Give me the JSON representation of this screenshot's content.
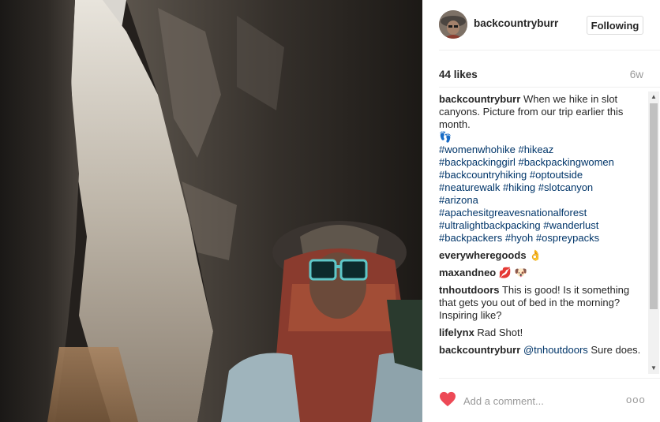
{
  "post": {
    "username": "backcountryburr",
    "follow_label": "Following",
    "likes": "44 likes",
    "age": "6w"
  },
  "caption": {
    "username": "backcountryburr",
    "text": "When we hike in slot canyons. Picture from our trip earlier this month.",
    "emoji": "👣",
    "hashtag_lines": [
      [
        "#womenwhohike",
        "#hikeaz"
      ],
      [
        "#backpackinggirl",
        "#backpackingwomen"
      ],
      [
        "#backcountryhiking",
        "#optoutside"
      ],
      [
        "#neaturewalk",
        "#hiking",
        "#slotcanyon"
      ],
      [
        "#arizona"
      ],
      [
        "#apachesitgreavesnationalforest"
      ],
      [
        "#ultralightbackpacking",
        "#wanderlust"
      ],
      [
        "#backpackers",
        "#hyoh",
        "#ospreypacks"
      ]
    ]
  },
  "comments": [
    {
      "username": "everywheregoods",
      "text": "👌"
    },
    {
      "username": "maxandneo",
      "text": "💋 🐶"
    },
    {
      "username": "tnhoutdoors",
      "text": "This is good! Is it something that gets you out of bed in the morning? Inspiring like?"
    },
    {
      "username": "lifelynx",
      "text": "Rad Shot!"
    },
    {
      "username": "backcountryburr",
      "mention": "@tnhoutdoors",
      "text": "Sure does."
    }
  ],
  "composer": {
    "placeholder": "Add a comment...",
    "more_label": "ooo"
  },
  "icons": {
    "like": "heart-icon",
    "more": "more-options-icon",
    "scroll_up": "scroll-up-arrow",
    "scroll_down": "scroll-down-arrow"
  },
  "colors": {
    "heart": "#ed4956",
    "hashtag": "#003569",
    "muted": "#999999"
  }
}
